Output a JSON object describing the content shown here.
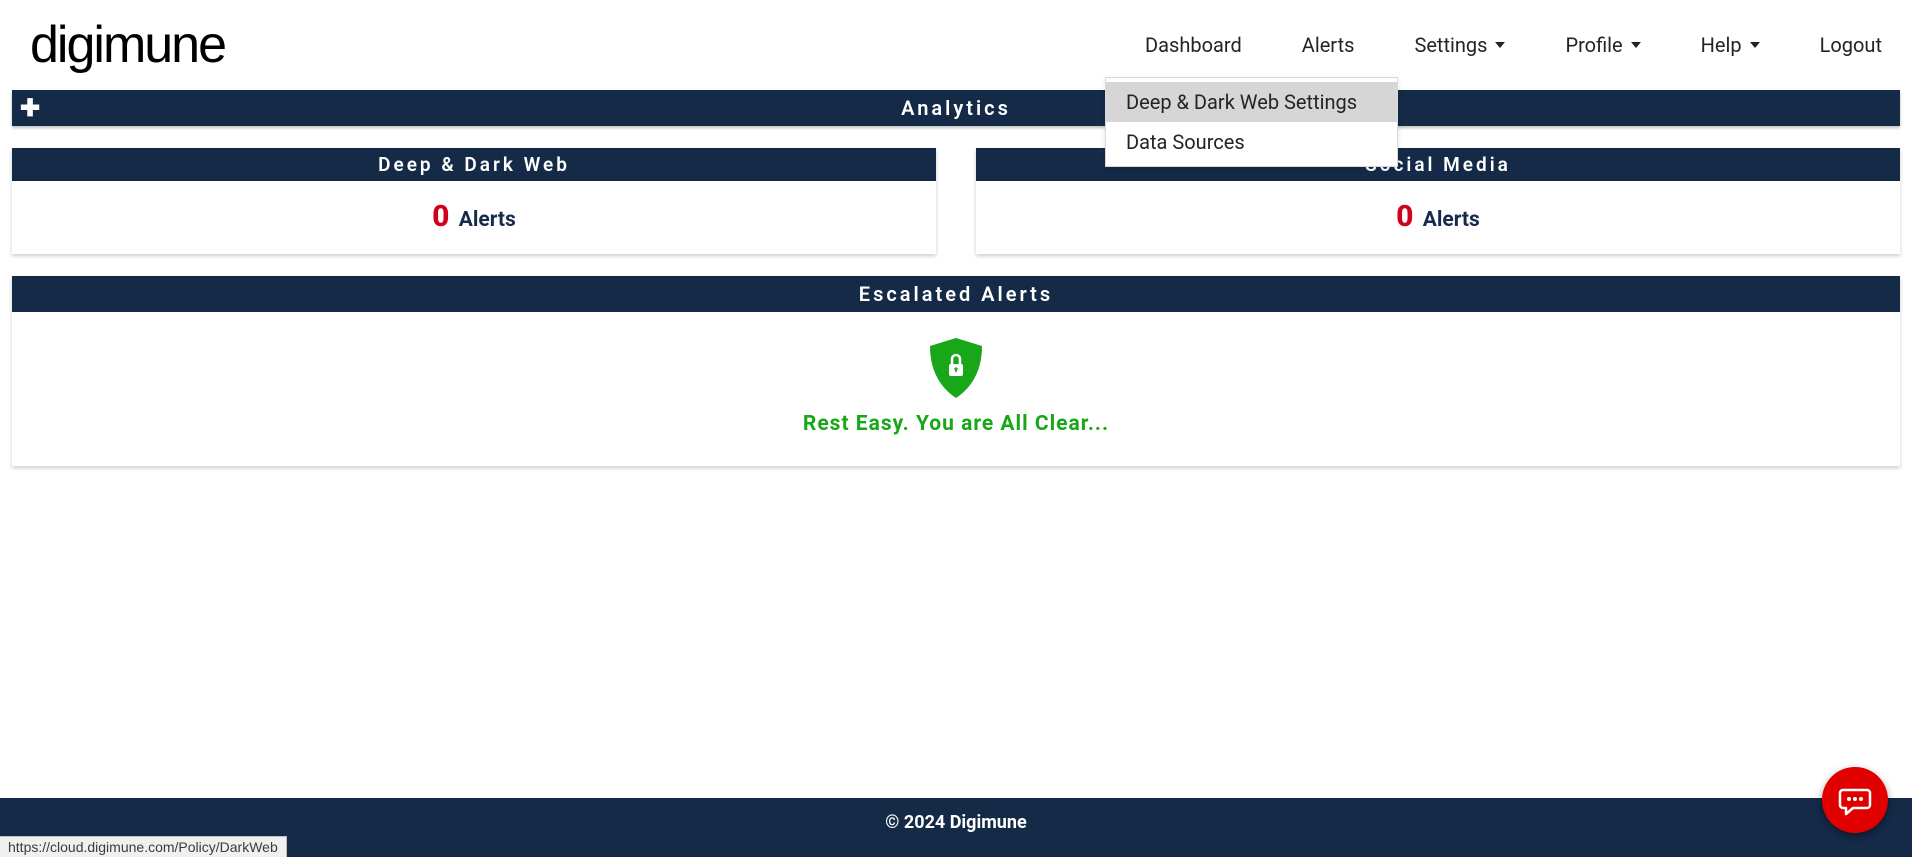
{
  "brand": "digimune",
  "nav": {
    "dashboard": "Dashboard",
    "alerts": "Alerts",
    "settings": "Settings",
    "profile": "Profile",
    "help": "Help",
    "logout": "Logout"
  },
  "settings_menu": {
    "item1": "Deep & Dark Web Settings",
    "item2": "Data Sources"
  },
  "analytics_header": "Analytics",
  "cards": {
    "dark_web": {
      "title": "Deep & Dark Web",
      "count": "0",
      "label": "Alerts"
    },
    "social": {
      "title": "Social Media",
      "count": "0",
      "label": "Alerts"
    }
  },
  "escalated": {
    "header": "Escalated Alerts",
    "message": "Rest Easy. You are All Clear..."
  },
  "footer": "© 2024 Digimune",
  "status_url": "https://cloud.digimune.com/Policy/DarkWeb"
}
